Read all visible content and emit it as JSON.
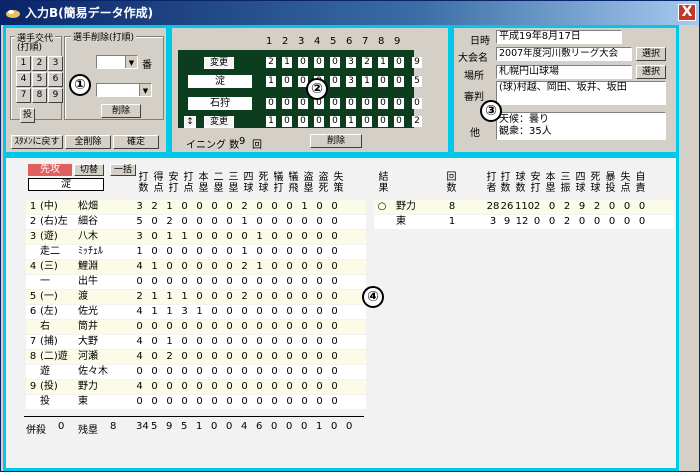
{
  "window": {
    "title": "入力B(簡易データ作成)",
    "close": "X"
  },
  "panel1": {
    "frame_a": "選手交代\n(打順)",
    "frame_b": "選手削除(打順)",
    "keys": [
      "1",
      "2",
      "3",
      "4",
      "5",
      "6",
      "7",
      "8",
      "9"
    ],
    "tou": "投",
    "ban": "番",
    "delete": "削除",
    "btn_back": "ｽﾀﾒﾝに戻す",
    "btn_clear": "全削除",
    "btn_confirm": "確定",
    "marker": "①"
  },
  "panel2": {
    "innings_header": [
      "1",
      "2",
      "3",
      "4",
      "5",
      "6",
      "7",
      "8",
      "9"
    ],
    "top": {
      "change": "変更",
      "team": "淀",
      "scores": [
        "2",
        "1",
        "0",
        "0",
        "0",
        "3",
        "2",
        "1",
        "0"
      ],
      "total": "9"
    },
    "mid": {
      "scores2": [
        "1",
        "0",
        "0",
        "0",
        "0",
        "3",
        "1",
        "0",
        "0"
      ],
      "total": "5"
    },
    "bottom": {
      "team": "石狩",
      "scores": [
        "0",
        "0",
        "0",
        "0",
        "0",
        "0",
        "0",
        "0",
        "0"
      ],
      "total": "0"
    },
    "last": {
      "change": "変更",
      "swap": "↕",
      "scores": [
        "1",
        "0",
        "0",
        "0",
        "0",
        "1",
        "0",
        "0",
        "0"
      ],
      "total": "2"
    },
    "inning_label": "イニング 数",
    "inning_val": "9",
    "inning_unit": "回",
    "delete": "削除",
    "marker": "②"
  },
  "panel3": {
    "date_label": "日時",
    "date": "平成19年8月17日",
    "tour_label": "大会名",
    "tour": "2007年度河川敷リーグ大会",
    "place_label": "場所",
    "place": "札幌円山球場",
    "select": "選択",
    "ump_label": "審判",
    "ump": "(球)村越、岡田、坂井、坂田",
    "other_label": "他",
    "weather": "天候：曇り",
    "crowd": "観衆：35人",
    "marker": "③"
  },
  "panel4": {
    "sente": "先攻",
    "kirikae": "切替",
    "ichiran": "一括",
    "team": "淀",
    "marker": "④",
    "bat_headers": [
      "打数",
      "得点",
      "安打",
      "打点",
      "本塁",
      "二塁",
      "三塁",
      "四球",
      "死球",
      "犠打",
      "犠飛",
      "盗塁",
      "盗死",
      "失策"
    ],
    "batters": [
      {
        "no": "1",
        "pos": "(中)",
        "name": "松畑",
        "v": [
          "3",
          "2",
          "1",
          "0",
          "0",
          "0",
          "0",
          "2",
          "0",
          "0",
          "0",
          "1",
          "0",
          "0"
        ]
      },
      {
        "no": "2",
        "pos": "(右)左",
        "name": "細谷",
        "v": [
          "5",
          "0",
          "2",
          "0",
          "0",
          "0",
          "0",
          "1",
          "0",
          "0",
          "0",
          "0",
          "0",
          "0"
        ]
      },
      {
        "no": "3",
        "pos": "(遊)",
        "name": "八木",
        "v": [
          "3",
          "0",
          "1",
          "1",
          "0",
          "0",
          "0",
          "0",
          "1",
          "0",
          "0",
          "0",
          "0",
          "0"
        ]
      },
      {
        "no": "",
        "pos": "走二",
        "name": "ﾐｯﾁｪﾙ",
        "v": [
          "1",
          "0",
          "0",
          "0",
          "0",
          "0",
          "0",
          "1",
          "0",
          "0",
          "0",
          "0",
          "0",
          "0"
        ]
      },
      {
        "no": "4",
        "pos": "(三)",
        "name": "鯉淵",
        "v": [
          "4",
          "1",
          "0",
          "0",
          "0",
          "0",
          "0",
          "2",
          "1",
          "0",
          "0",
          "0",
          "0",
          "0"
        ]
      },
      {
        "no": "",
        "pos": "一",
        "name": "出牛",
        "v": [
          "0",
          "0",
          "0",
          "0",
          "0",
          "0",
          "0",
          "0",
          "0",
          "0",
          "0",
          "0",
          "0",
          "0"
        ]
      },
      {
        "no": "5",
        "pos": "(一)",
        "name": "渡",
        "v": [
          "2",
          "1",
          "1",
          "1",
          "0",
          "0",
          "0",
          "2",
          "0",
          "0",
          "0",
          "0",
          "0",
          "0"
        ]
      },
      {
        "no": "6",
        "pos": "(左)",
        "name": "佐光",
        "v": [
          "4",
          "1",
          "1",
          "3",
          "1",
          "0",
          "0",
          "0",
          "0",
          "0",
          "0",
          "0",
          "0",
          "0"
        ]
      },
      {
        "no": "",
        "pos": "右",
        "name": "筒井",
        "v": [
          "0",
          "0",
          "0",
          "0",
          "0",
          "0",
          "0",
          "0",
          "0",
          "0",
          "0",
          "0",
          "0",
          "0"
        ]
      },
      {
        "no": "7",
        "pos": "(捕)",
        "name": "大野",
        "v": [
          "4",
          "0",
          "1",
          "0",
          "0",
          "0",
          "0",
          "0",
          "0",
          "0",
          "0",
          "0",
          "0",
          "0"
        ]
      },
      {
        "no": "8",
        "pos": "(二)遊",
        "name": "河瀬",
        "v": [
          "4",
          "0",
          "2",
          "0",
          "0",
          "0",
          "0",
          "0",
          "0",
          "0",
          "0",
          "0",
          "0",
          "0"
        ]
      },
      {
        "no": "",
        "pos": "遊",
        "name": "佐々木",
        "v": [
          "0",
          "0",
          "0",
          "0",
          "0",
          "0",
          "0",
          "0",
          "0",
          "0",
          "0",
          "0",
          "0",
          "0"
        ]
      },
      {
        "no": "9",
        "pos": "(投)",
        "name": "野力",
        "v": [
          "4",
          "0",
          "0",
          "0",
          "0",
          "0",
          "0",
          "0",
          "0",
          "0",
          "0",
          "0",
          "0",
          "0"
        ]
      },
      {
        "no": "",
        "pos": "投",
        "name": "東",
        "v": [
          "0",
          "0",
          "0",
          "0",
          "0",
          "0",
          "0",
          "0",
          "0",
          "0",
          "0",
          "0",
          "0",
          "0"
        ]
      }
    ],
    "footer": {
      "gisatsu_label": "併殺",
      "gisatsu": "0",
      "zanrui_label": "残塁",
      "zanrui": "8",
      "totals": [
        "34",
        "5",
        "9",
        "5",
        "1",
        "0",
        "0",
        "4",
        "6",
        "0",
        "0",
        "0",
        "1",
        "0",
        "0"
      ]
    },
    "pit_headers": [
      "結果",
      "回数",
      "打者",
      "打数",
      "球数",
      "安打",
      "本塁",
      "三振",
      "四球",
      "死球",
      "暴投",
      "失点",
      "自責"
    ],
    "pitchers": [
      {
        "mark": "○",
        "name": "野力",
        "inn": "8",
        "v": [
          "28",
          "26",
          "110",
          "2",
          "0",
          "2",
          "9",
          "2",
          "0",
          "0",
          "0"
        ]
      },
      {
        "mark": "",
        "name": "東",
        "inn": "1",
        "v": [
          "3",
          "9",
          "12",
          "0",
          "0",
          "2",
          "0",
          "0",
          "0",
          "0",
          "0"
        ]
      }
    ]
  }
}
